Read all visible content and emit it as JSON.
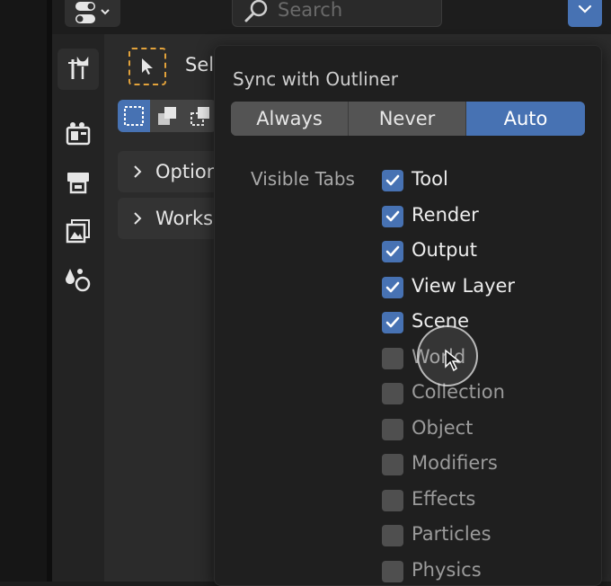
{
  "header": {
    "search_placeholder": "Search",
    "editor_type_icon": "properties-editor-icon",
    "dropdown_icon": "chevron-down-icon"
  },
  "tabs": [
    {
      "icon": "tool-icon",
      "active": true
    },
    {
      "icon": "render-icon",
      "active": false
    },
    {
      "icon": "output-icon",
      "active": false
    },
    {
      "icon": "view-layer-icon",
      "active": false
    },
    {
      "icon": "scene-icon",
      "active": false
    }
  ],
  "tool_panel": {
    "select_label_partial": "Sel",
    "options_label_partial": "Option",
    "workspace_label_partial": "Works"
  },
  "popup": {
    "sync_title": "Sync with Outliner",
    "sync_options": [
      "Always",
      "Never",
      "Auto"
    ],
    "sync_selected": "Auto",
    "visible_tabs_label": "Visible Tabs",
    "visible_tabs": [
      {
        "label": "Tool",
        "checked": true
      },
      {
        "label": "Render",
        "checked": true
      },
      {
        "label": "Output",
        "checked": true
      },
      {
        "label": "View Layer",
        "checked": true
      },
      {
        "label": "Scene",
        "checked": true
      },
      {
        "label": "World",
        "checked": false
      },
      {
        "label": "Collection",
        "checked": false
      },
      {
        "label": "Object",
        "checked": false
      },
      {
        "label": "Modifiers",
        "checked": false
      },
      {
        "label": "Effects",
        "checked": false
      },
      {
        "label": "Particles",
        "checked": false
      },
      {
        "label": "Physics",
        "checked": false
      }
    ]
  },
  "colors": {
    "accent": "#4772b3",
    "background": "#1d1d1d",
    "popup_bg": "#1f1f1f",
    "select_tool_outline": "#e2a23b"
  }
}
